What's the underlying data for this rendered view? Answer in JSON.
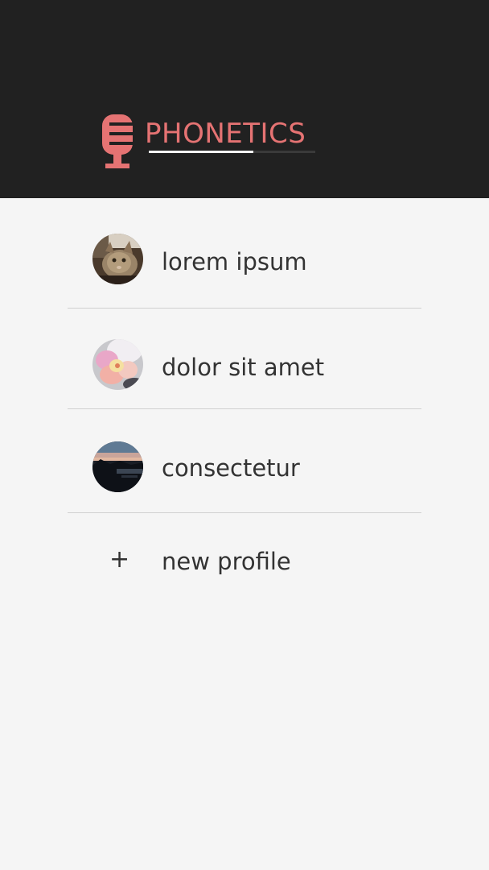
{
  "header": {
    "title": "PHONETICS",
    "title_color": "#e57373",
    "background": "#212121",
    "logo_icon": "microphone-icon",
    "title_underline_progress": 0.63
  },
  "profiles": [
    {
      "name": "lorem ipsum",
      "avatar": "cat-photo"
    },
    {
      "name": "dolor sit amet",
      "avatar": "orchid-flower-photo"
    },
    {
      "name": "consectetur",
      "avatar": "sunset-lake-photo"
    }
  ],
  "new_profile": {
    "icon": "+",
    "label": "new profile"
  }
}
